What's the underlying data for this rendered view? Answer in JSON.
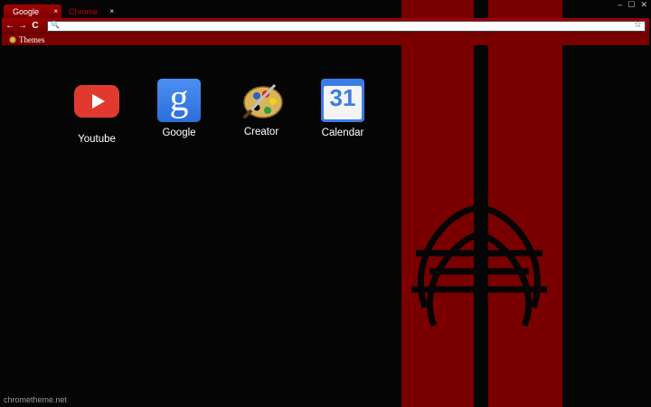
{
  "browser": {
    "tabs": [
      {
        "label": "Google",
        "close": "×"
      },
      {
        "label": "Chrome",
        "close": "×"
      }
    ],
    "window_controls": [
      "–",
      "☐",
      "✕"
    ],
    "nav": {
      "back": "←",
      "forward": "→",
      "reload": "C"
    },
    "omnibox": {
      "search_icon": "🔍",
      "star": "☆",
      "value": ""
    },
    "bookmarks": [
      {
        "label": "Themes",
        "icon": "palette-icon"
      }
    ]
  },
  "apps": [
    {
      "label": "Youtube",
      "icon": "youtube-icon"
    },
    {
      "label": "Google",
      "icon": "google-icon",
      "glyph": "g"
    },
    {
      "label": "Creator",
      "icon": "palette-icon"
    },
    {
      "label": "Calendar",
      "icon": "calendar-icon",
      "glyph": "31"
    }
  ],
  "footer": {
    "text": "chrometheme.net"
  },
  "colors": {
    "accent": "#8b0000",
    "band": "#7a0000",
    "background": "#050505"
  }
}
